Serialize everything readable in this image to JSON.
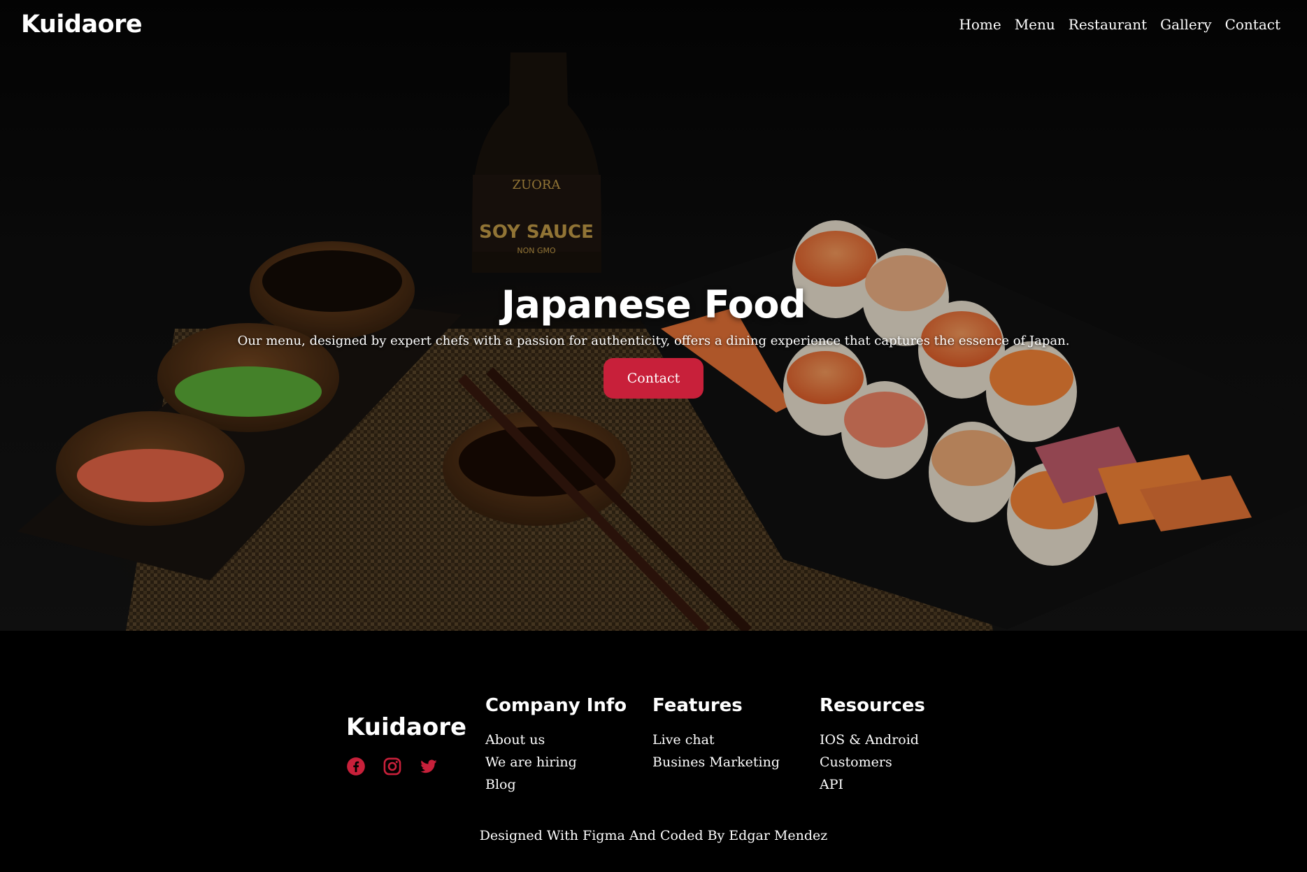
{
  "header": {
    "brand": "Kuidaore",
    "nav": [
      "Home",
      "Menu",
      "Restaurant",
      "Gallery",
      "Contact"
    ]
  },
  "hero": {
    "title": "Japanese Food",
    "subtitle": "Our menu, designed by expert chefs with a passion for authenticity, offers a dining experience that captures the essence of Japan.",
    "button_label": "Contact",
    "bottle_brand": "ZUORA",
    "bottle_label": "SOY SAUCE",
    "bottle_tag": "NON GMO"
  },
  "footer": {
    "brand": "Kuidaore",
    "socials": [
      "facebook-icon",
      "instagram-icon",
      "twitter-icon"
    ],
    "columns": [
      {
        "title": "Company Info",
        "links": [
          "About us",
          "We are hiring",
          "Blog"
        ]
      },
      {
        "title": "Features",
        "links": [
          "Live chat",
          "Busines Marketing"
        ]
      },
      {
        "title": "Resources",
        "links": [
          "IOS & Android",
          "Customers",
          "API"
        ]
      }
    ],
    "credit": "Designed With Figma And Coded By Edgar Mendez"
  },
  "colors": {
    "accent": "#c8203a",
    "background": "#000000",
    "text": "#ffffff"
  }
}
